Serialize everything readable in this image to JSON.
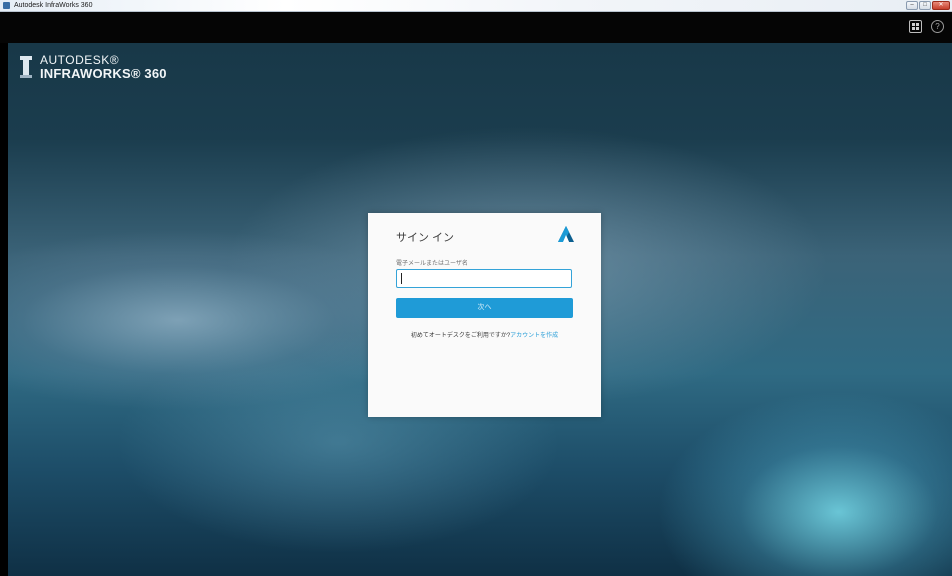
{
  "window": {
    "title": "Autodesk InfraWorks 360",
    "controls": {
      "minimize": "–",
      "maximize": "□",
      "close": "✕"
    }
  },
  "appbar": {
    "help_glyph": "?"
  },
  "brand": {
    "line1": "AUTODESK®",
    "line2": "INFRAWORKS® 360"
  },
  "signin": {
    "title": "サイン イン",
    "field_label": "電子メールまたはユーザ名",
    "field_value": "",
    "next_label": "次へ",
    "prompt_text": "初めてオートデスクをご利用ですか?",
    "create_account_link": "アカウントを作成"
  },
  "colors": {
    "accent": "#1f9bd7",
    "link": "#2b9fd8",
    "card_bg": "#fafafa"
  },
  "icons": {
    "app": "app-icon",
    "grid": "grid-icon",
    "help": "help-icon",
    "brand": "infraworks-logo",
    "autodesk": "autodesk-logo"
  }
}
